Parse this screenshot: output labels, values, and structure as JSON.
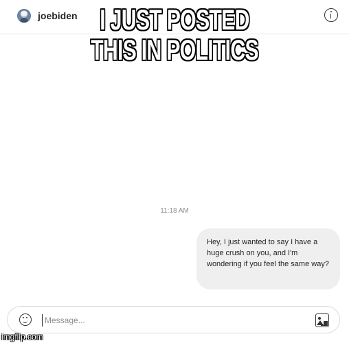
{
  "header": {
    "username": "joebiden"
  },
  "meme": {
    "caption": "I JUST POSTED\nTHIS IN POLITICS"
  },
  "conversation": {
    "timestamp": "11:18 AM",
    "messages": [
      {
        "text": "Hey, I just wanted to say I have a huge crush on you, and I'm wondering if you feel the same way?"
      }
    ]
  },
  "composer": {
    "placeholder": "Message..."
  },
  "watermark": {
    "text": "imgflip.com"
  },
  "icons": {
    "profile": "avatar",
    "info": "info-icon",
    "emoji": "emoji-icon",
    "image": "image-icon"
  }
}
